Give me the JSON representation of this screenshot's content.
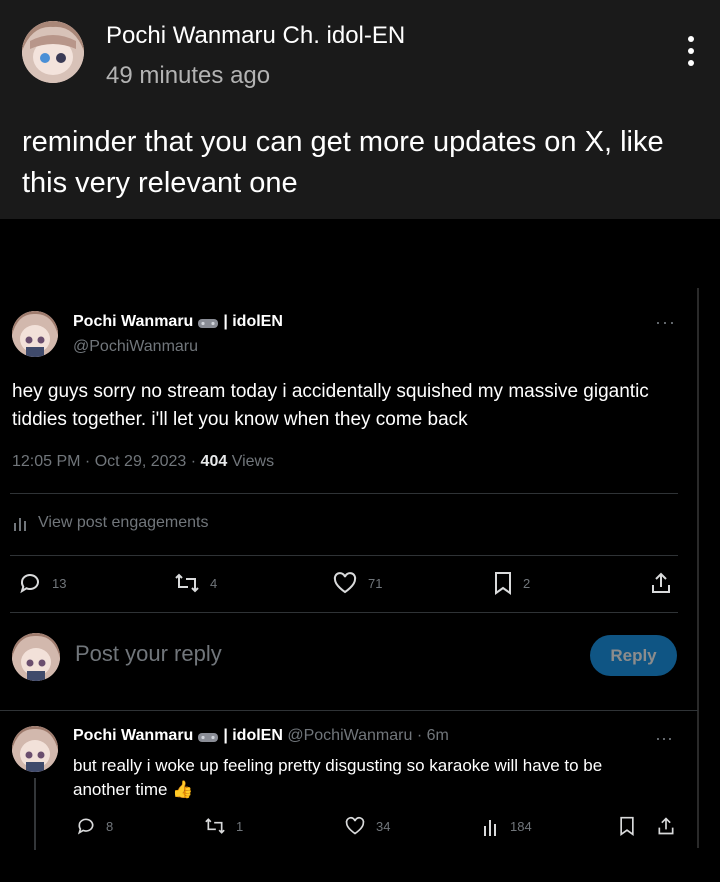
{
  "post": {
    "author": "Pochi Wanmaru Ch. idol-EN",
    "time": "49 minutes ago",
    "body": "reminder that you can get more updates on X, like this very relevant one",
    "more_icon": "kebab-vertical-icon"
  },
  "tweet": {
    "name": "Pochi Wanmaru",
    "name_suffix": "| idolEN",
    "handle": "@PochiWanmaru",
    "body": "hey guys sorry no stream today i accidentally squished my massive gigantic tiddies together. i'll let you know when they come back",
    "time": "12:05 PM · Oct 29, 2023 · ",
    "views_count": "404",
    "views_label": " Views",
    "engagements": "View post engagements",
    "actions": {
      "replies": "13",
      "reposts": "4",
      "likes": "71",
      "bookmarks": "2"
    },
    "more": "···"
  },
  "reply_box": {
    "placeholder": "Post your reply",
    "button": "Reply"
  },
  "reply": {
    "name": "Pochi Wanmaru",
    "name_suffix": "| idolEN",
    "handle": "@PochiWanmaru",
    "age": " · 6m",
    "body": "but really i woke up feeling pretty disgusting so karaoke will have to be another time",
    "emoji": "👍",
    "actions": {
      "replies": "8",
      "reposts": "1",
      "likes": "34",
      "views": "184"
    },
    "more": "···"
  },
  "colors": {
    "accent": "#1d9bf0",
    "muted": "#71767b",
    "card_bg": "#1a1a1a"
  }
}
